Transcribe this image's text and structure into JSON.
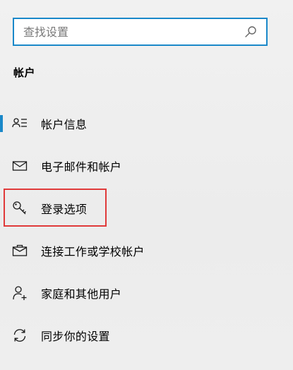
{
  "search": {
    "placeholder": "查找设置",
    "value": "",
    "icon": "search-icon"
  },
  "section": {
    "title": "帐户"
  },
  "nav": {
    "accent_color": "#1a88c9",
    "highlight_color": "#e03a3a",
    "items": [
      {
        "label": "帐户信息",
        "icon": "account-info-icon",
        "selected": true
      },
      {
        "label": "电子邮件和帐户",
        "icon": "mail-icon",
        "selected": false
      },
      {
        "label": "登录选项",
        "icon": "key-icon",
        "selected": false,
        "highlighted": true
      },
      {
        "label": "连接工作或学校帐户",
        "icon": "briefcase-icon",
        "selected": false
      },
      {
        "label": "家庭和其他用户",
        "icon": "add-person-icon",
        "selected": false
      },
      {
        "label": "同步你的设置",
        "icon": "sync-icon",
        "selected": false
      }
    ]
  }
}
